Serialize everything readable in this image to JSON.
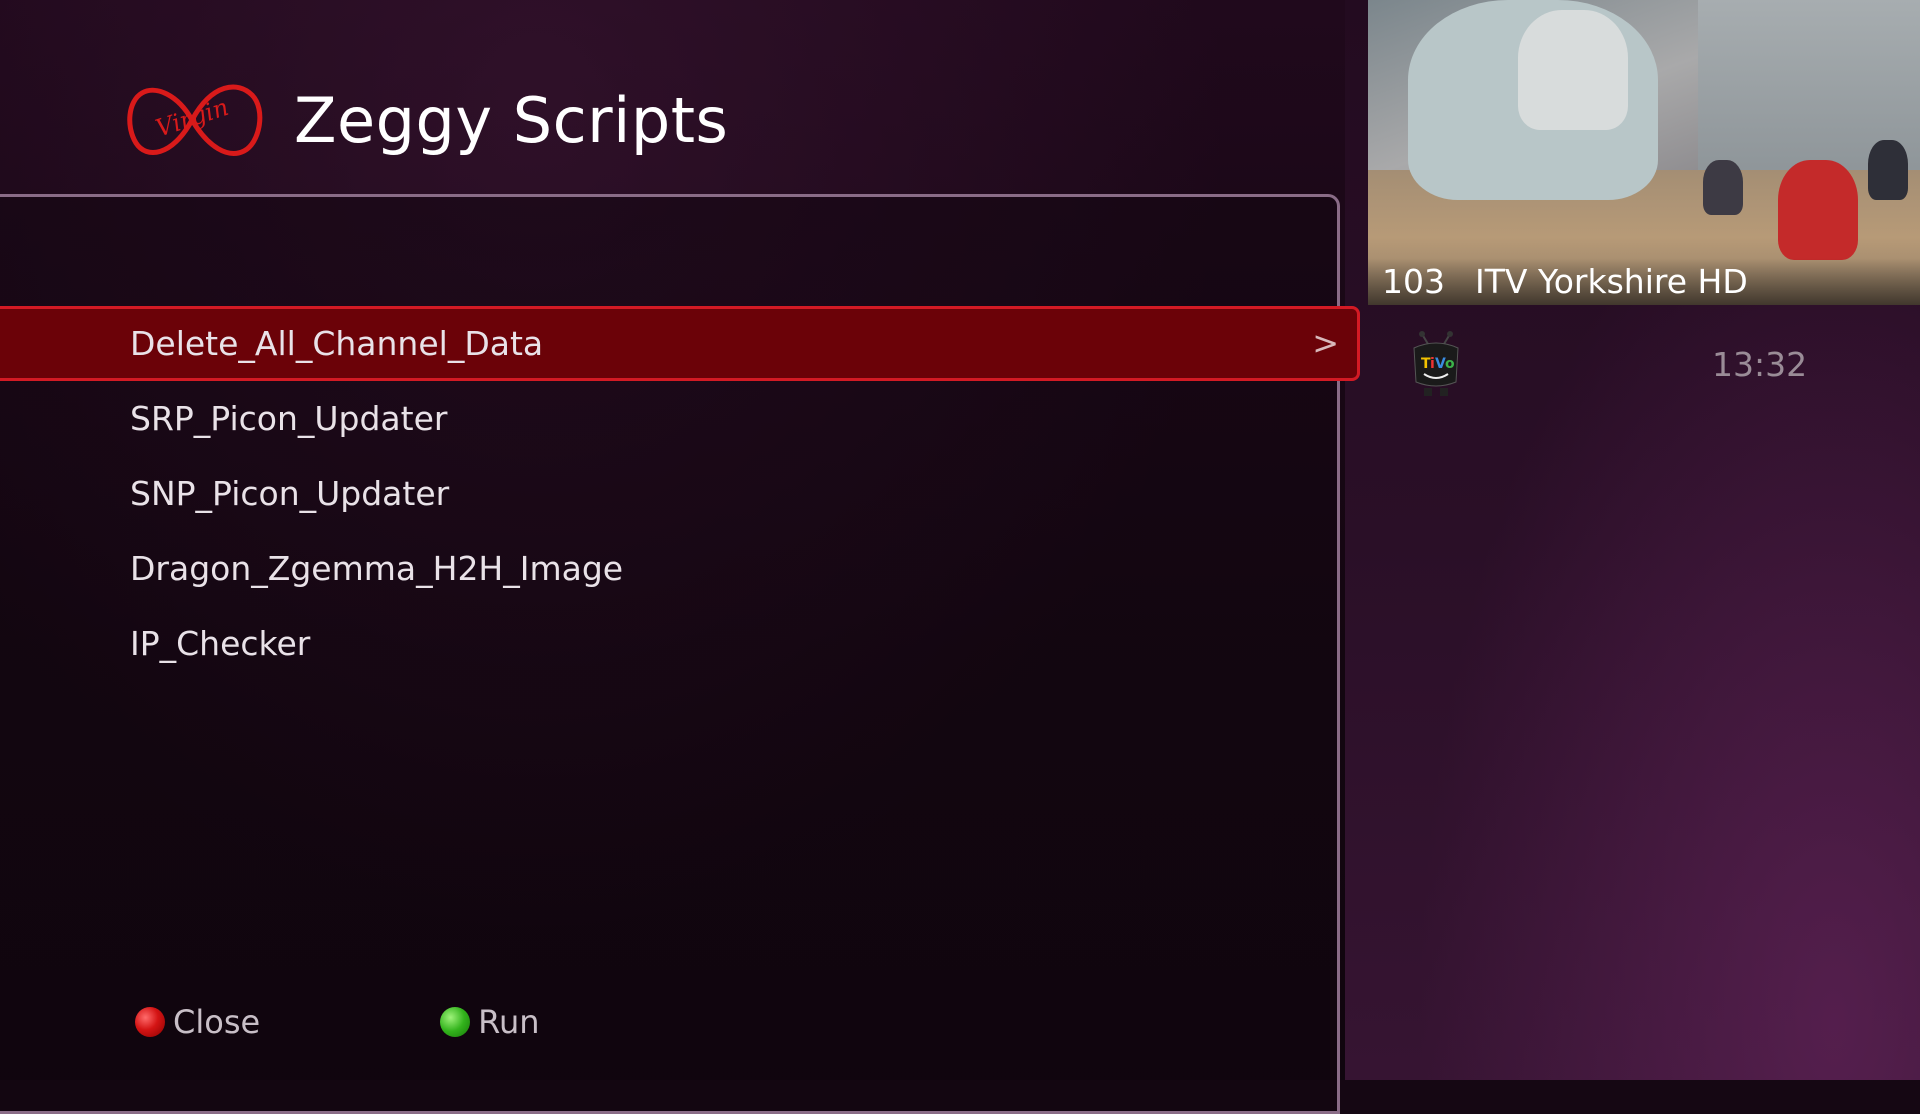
{
  "header": {
    "title": "Zeggy Scripts",
    "logo": "virgin-media-logo"
  },
  "menu": {
    "items": [
      {
        "label": "Delete_All_Channel_Data",
        "selected": true
      },
      {
        "label": "SRP_Picon_Updater"
      },
      {
        "label": "SNP_Picon_Updater"
      },
      {
        "label": "Dragon_Zgemma_H2H_Image"
      },
      {
        "label": "IP_Checker"
      }
    ],
    "chevron": ">"
  },
  "footer": {
    "close_label": "Close",
    "run_label": "Run",
    "colors": {
      "close": "#d41414",
      "run": "#32b31c"
    }
  },
  "preview": {
    "channel_number": "103",
    "channel_name": "ITV Yorkshire HD"
  },
  "status": {
    "time": "13:32",
    "icon": "tivo-icon"
  },
  "colors": {
    "accent": "#6b0208",
    "accent_border": "#d31a24"
  }
}
